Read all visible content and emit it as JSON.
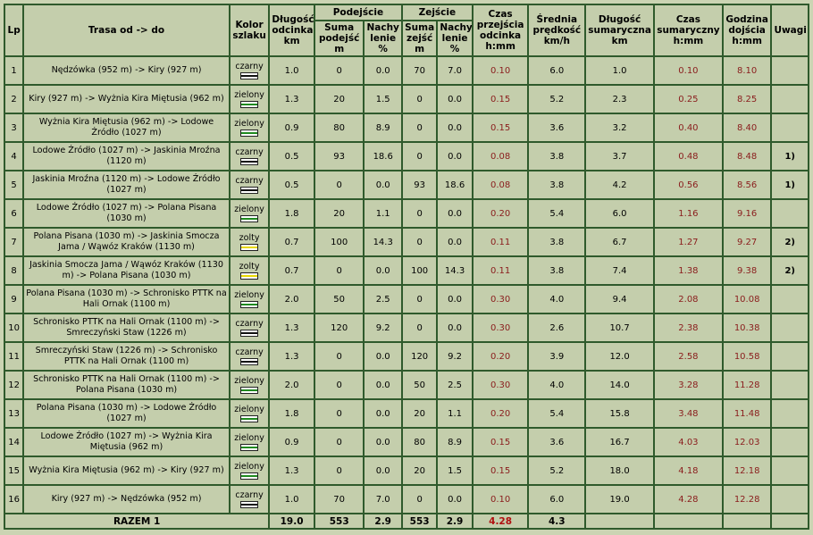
{
  "headers": {
    "lp": "Lp",
    "trasa": "Trasa od -> do",
    "kolor": "Kolor szlaku",
    "dlugosc": "Długość odcinka km",
    "podejscie": "Podejście",
    "zejscie": "Zejście",
    "suma_podejsc": "Suma podejść m",
    "nachylenie": "Nachy lenie %",
    "suma_zejsc": "Suma zejść m",
    "czas": "Czas przejścia odcinka h:mm",
    "predkosc": "Średnia prędkość km/h",
    "dlugosc_sum": "Długość sumaryczna km",
    "czas_sum": "Czas sumaryczny h:mm",
    "godzina": "Godzina dojścia h:mm",
    "uwagi": "Uwagi"
  },
  "colors": {
    "czarny": {
      "edge": "#ffffff",
      "line": "#111111"
    },
    "zielony": {
      "edge": "#ffffff",
      "line": "#1f8a1f"
    },
    "zolty": {
      "edge": "#ffffff",
      "line": "#e8d800"
    }
  },
  "rows": [
    {
      "lp": "1",
      "trasa": "Nędzówka (952 m) -> Kiry (927 m)",
      "kolor": "czarny",
      "marker": "czarny",
      "dl": "1.0",
      "podejscie": "0",
      "nach_p": "0.0",
      "zejscie": "70",
      "nach_z": "7.0",
      "czas": "0.10",
      "predkosc": "6.0",
      "dl_sum": "1.0",
      "czas_sum": "0.10",
      "godzina": "8.10",
      "uwagi": ""
    },
    {
      "lp": "2",
      "trasa": "Kiry (927 m) -> Wyżnia Kira Miętusia (962 m)",
      "kolor": "zielony",
      "marker": "zielony",
      "dl": "1.3",
      "podejscie": "20",
      "nach_p": "1.5",
      "zejscie": "0",
      "nach_z": "0.0",
      "czas": "0.15",
      "predkosc": "5.2",
      "dl_sum": "2.3",
      "czas_sum": "0.25",
      "godzina": "8.25",
      "uwagi": ""
    },
    {
      "lp": "3",
      "trasa": "Wyżnia Kira Miętusia (962 m) -> Lodowe Źródło (1027 m)",
      "kolor": "zielony",
      "marker": "zielony",
      "dl": "0.9",
      "podejscie": "80",
      "nach_p": "8.9",
      "zejscie": "0",
      "nach_z": "0.0",
      "czas": "0.15",
      "predkosc": "3.6",
      "dl_sum": "3.2",
      "czas_sum": "0.40",
      "godzina": "8.40",
      "uwagi": ""
    },
    {
      "lp": "4",
      "trasa": "Lodowe Źródło (1027 m) -> Jaskinia Mroźna (1120 m)",
      "kolor": "czarny",
      "marker": "czarny",
      "dl": "0.5",
      "podejscie": "93",
      "nach_p": "18.6",
      "zejscie": "0",
      "nach_z": "0.0",
      "czas": "0.08",
      "predkosc": "3.8",
      "dl_sum": "3.7",
      "czas_sum": "0.48",
      "godzina": "8.48",
      "uwagi": "1)"
    },
    {
      "lp": "5",
      "trasa": "Jaskinia Mroźna (1120 m) -> Lodowe Źródło (1027 m)",
      "kolor": "czarny",
      "marker": "czarny",
      "dl": "0.5",
      "podejscie": "0",
      "nach_p": "0.0",
      "zejscie": "93",
      "nach_z": "18.6",
      "czas": "0.08",
      "predkosc": "3.8",
      "dl_sum": "4.2",
      "czas_sum": "0.56",
      "godzina": "8.56",
      "uwagi": "1)"
    },
    {
      "lp": "6",
      "trasa": "Lodowe Źródło (1027 m) -> Polana Pisana (1030 m)",
      "kolor": "zielony",
      "marker": "zielony",
      "dl": "1.8",
      "podejscie": "20",
      "nach_p": "1.1",
      "zejscie": "0",
      "nach_z": "0.0",
      "czas": "0.20",
      "predkosc": "5.4",
      "dl_sum": "6.0",
      "czas_sum": "1.16",
      "godzina": "9.16",
      "uwagi": ""
    },
    {
      "lp": "7",
      "trasa": "Polana Pisana (1030 m) -> Jaskinia Smocza Jama / Wąwóz Kraków (1130 m)",
      "kolor": "zolty",
      "marker": "zolty",
      "dl": "0.7",
      "podejscie": "100",
      "nach_p": "14.3",
      "zejscie": "0",
      "nach_z": "0.0",
      "czas": "0.11",
      "predkosc": "3.8",
      "dl_sum": "6.7",
      "czas_sum": "1.27",
      "godzina": "9.27",
      "uwagi": "2)"
    },
    {
      "lp": "8",
      "trasa": "Jaskinia Smocza Jama / Wąwóz Kraków (1130 m) -> Polana Pisana (1030 m)",
      "kolor": "zolty",
      "marker": "zolty",
      "dl": "0.7",
      "podejscie": "0",
      "nach_p": "0.0",
      "zejscie": "100",
      "nach_z": "14.3",
      "czas": "0.11",
      "predkosc": "3.8",
      "dl_sum": "7.4",
      "czas_sum": "1.38",
      "godzina": "9.38",
      "uwagi": "2)"
    },
    {
      "lp": "9",
      "trasa": "Polana Pisana (1030 m) -> Schronisko PTTK na Hali Ornak (1100 m)",
      "kolor": "zielony",
      "marker": "zielony",
      "dl": "2.0",
      "podejscie": "50",
      "nach_p": "2.5",
      "zejscie": "0",
      "nach_z": "0.0",
      "czas": "0.30",
      "predkosc": "4.0",
      "dl_sum": "9.4",
      "czas_sum": "2.08",
      "godzina": "10.08",
      "uwagi": ""
    },
    {
      "lp": "10",
      "trasa": "Schronisko PTTK na Hali Ornak (1100 m) -> Smreczyński Staw (1226 m)",
      "kolor": "czarny",
      "marker": "czarny",
      "dl": "1.3",
      "podejscie": "120",
      "nach_p": "9.2",
      "zejscie": "0",
      "nach_z": "0.0",
      "czas": "0.30",
      "predkosc": "2.6",
      "dl_sum": "10.7",
      "czas_sum": "2.38",
      "godzina": "10.38",
      "uwagi": ""
    },
    {
      "lp": "11",
      "trasa": "Smreczyński Staw (1226 m) -> Schronisko PTTK na Hali Ornak (1100 m)",
      "kolor": "czarny",
      "marker": "czarny",
      "dl": "1.3",
      "podejscie": "0",
      "nach_p": "0.0",
      "zejscie": "120",
      "nach_z": "9.2",
      "czas": "0.20",
      "predkosc": "3.9",
      "dl_sum": "12.0",
      "czas_sum": "2.58",
      "godzina": "10.58",
      "uwagi": ""
    },
    {
      "lp": "12",
      "trasa": "Schronisko PTTK na Hali Ornak (1100 m) -> Polana Pisana (1030 m)",
      "kolor": "zielony",
      "marker": "zielony",
      "dl": "2.0",
      "podejscie": "0",
      "nach_p": "0.0",
      "zejscie": "50",
      "nach_z": "2.5",
      "czas": "0.30",
      "predkosc": "4.0",
      "dl_sum": "14.0",
      "czas_sum": "3.28",
      "godzina": "11.28",
      "uwagi": ""
    },
    {
      "lp": "13",
      "trasa": "Polana Pisana (1030 m) -> Lodowe Źródło (1027 m)",
      "kolor": "zielony",
      "marker": "zielony",
      "dl": "1.8",
      "podejscie": "0",
      "nach_p": "0.0",
      "zejscie": "20",
      "nach_z": "1.1",
      "czas": "0.20",
      "predkosc": "5.4",
      "dl_sum": "15.8",
      "czas_sum": "3.48",
      "godzina": "11.48",
      "uwagi": ""
    },
    {
      "lp": "14",
      "trasa": "Lodowe Źródło (1027 m) -> Wyżnia Kira Miętusia (962 m)",
      "kolor": "zielony",
      "marker": "zielony",
      "dl": "0.9",
      "podejscie": "0",
      "nach_p": "0.0",
      "zejscie": "80",
      "nach_z": "8.9",
      "czas": "0.15",
      "predkosc": "3.6",
      "dl_sum": "16.7",
      "czas_sum": "4.03",
      "godzina": "12.03",
      "uwagi": ""
    },
    {
      "lp": "15",
      "trasa": "Wyżnia Kira Miętusia (962 m) -> Kiry (927 m)",
      "kolor": "zielony",
      "marker": "zielony",
      "dl": "1.3",
      "podejscie": "0",
      "nach_p": "0.0",
      "zejscie": "20",
      "nach_z": "1.5",
      "czas": "0.15",
      "predkosc": "5.2",
      "dl_sum": "18.0",
      "czas_sum": "4.18",
      "godzina": "12.18",
      "uwagi": ""
    },
    {
      "lp": "16",
      "trasa": "Kiry (927 m) -> Nędzówka (952 m)",
      "kolor": "czarny",
      "marker": "czarny",
      "dl": "1.0",
      "podejscie": "70",
      "nach_p": "7.0",
      "zejscie": "0",
      "nach_z": "0.0",
      "czas": "0.10",
      "predkosc": "6.0",
      "dl_sum": "19.0",
      "czas_sum": "4.28",
      "godzina": "12.28",
      "uwagi": ""
    }
  ],
  "footer": {
    "label": "RAZEM 1",
    "dl": "19.0",
    "podejscie": "553",
    "nach_p": "2.9",
    "zejscie": "553",
    "nach_z": "2.9",
    "czas": "4.28",
    "predkosc": "4.3"
  }
}
